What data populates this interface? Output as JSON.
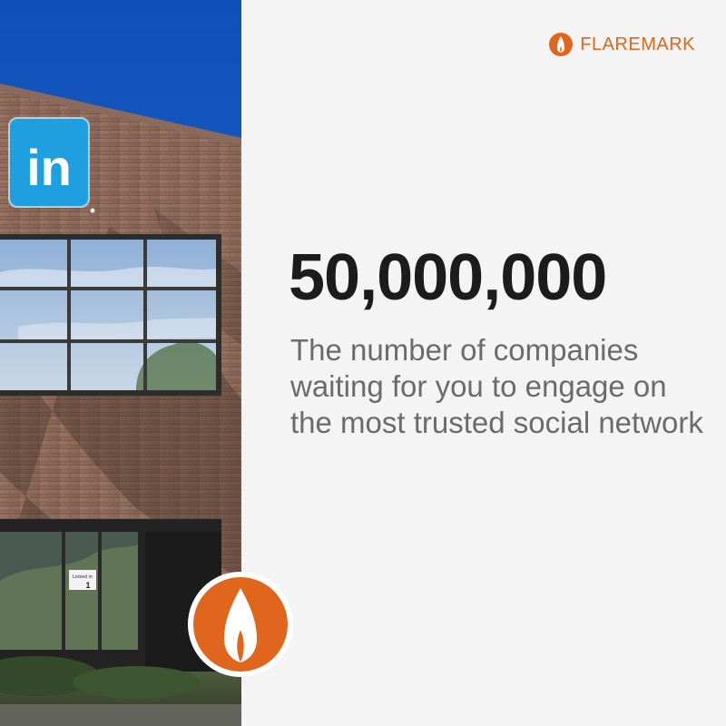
{
  "brand": {
    "name": "FLAREMARK",
    "accent_color": "#e0661d",
    "icon": "flame-logo-icon"
  },
  "headline": {
    "number": "50,000,000",
    "tagline": "The number of companies waiting for you to engage on the most trusted social network"
  },
  "photo": {
    "sign_text": "in",
    "door_sign": "Linked in",
    "door_number": "1"
  },
  "colors": {
    "background": "#f4f4f4",
    "number": "#1c1c1c",
    "tagline": "#6b6b6b",
    "sky": "#1e63c9",
    "linkedin_blue": "#1ea0e0"
  }
}
